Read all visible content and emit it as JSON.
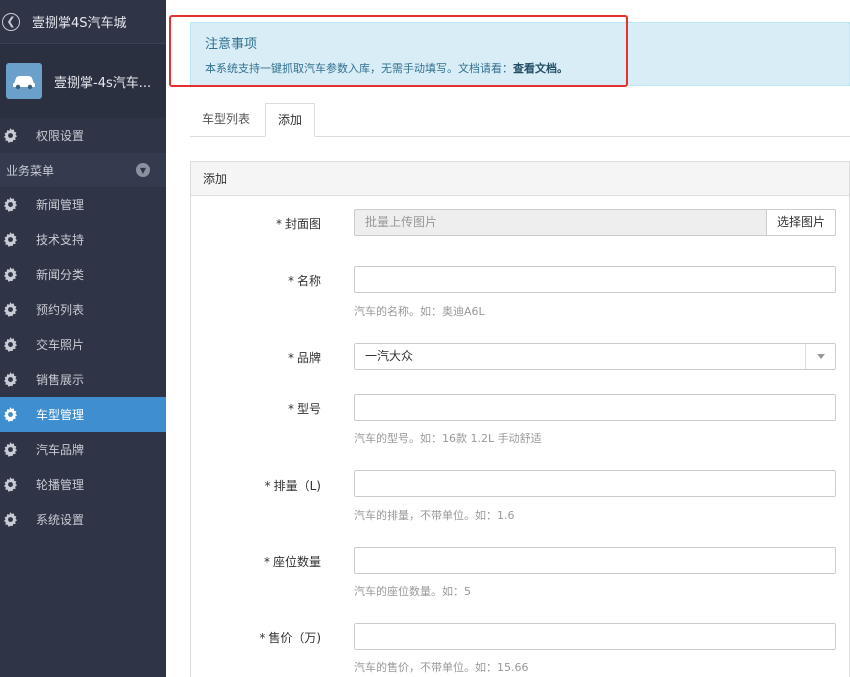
{
  "sidebar": {
    "top_title": "壹捌掌4S汽车城",
    "shop_name": "壹捌掌-4s汽车...",
    "items_before": [
      {
        "label": "权限设置"
      }
    ],
    "group_label": "业务菜单",
    "items": [
      {
        "label": "新闻管理"
      },
      {
        "label": "技术支持"
      },
      {
        "label": "新闻分类"
      },
      {
        "label": "预约列表"
      },
      {
        "label": "交车照片"
      },
      {
        "label": "销售展示"
      },
      {
        "label": "车型管理",
        "active": true
      },
      {
        "label": "汽车品牌"
      },
      {
        "label": "轮播管理"
      },
      {
        "label": "系统设置"
      }
    ]
  },
  "notice": {
    "title": "注意事项",
    "body": "本系统支持一键抓取汽车参数入库，无需手动填写。文档请看：",
    "link": "查看文档。"
  },
  "tabs": [
    {
      "label": "车型列表"
    },
    {
      "label": "添加"
    }
  ],
  "panel": {
    "title": "添加"
  },
  "form": {
    "cover": {
      "label": "封面图",
      "placeholder": "批量上传图片",
      "button": "选择图片"
    },
    "name": {
      "label": "名称",
      "hint": "汽车的名称。如：奥迪A6L"
    },
    "brand": {
      "label": "品牌",
      "value": "一汽大众"
    },
    "model": {
      "label": "型号",
      "hint": "汽车的型号。如：16款 1.2L 手动舒适"
    },
    "displacement": {
      "label": "排量（L)",
      "hint": "汽车的排量，不带单位。如：1.6"
    },
    "seats": {
      "label": "座位数量",
      "hint": "汽车的座位数量。如：5"
    },
    "price": {
      "label": "售价（万)",
      "hint": "汽车的售价，不带单位。如：15.66"
    }
  },
  "colors": {
    "sidebar_bg": "#2f3446",
    "active": "#3e8ed0",
    "notice_bg": "#d9edf7",
    "highlight": "#e53030"
  }
}
